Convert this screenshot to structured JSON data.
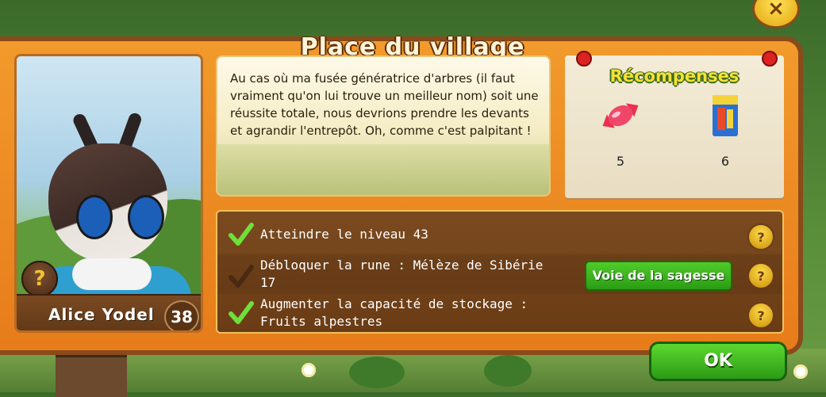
{
  "window": {
    "title": "Place du village",
    "close_label": "×"
  },
  "character": {
    "name": "Alice Yodel",
    "level": "38",
    "help_label": "?"
  },
  "dialog": {
    "text": "Au cas où ma fusée génératrice d'arbres (il faut vraiment qu'on lui trouve un meilleur nom) soit une réussite totale, nous devrions prendre les devants et agrandir l'entrepôt. Oh, comme c'est palpitant !"
  },
  "rewards": {
    "heading": "Récompenses",
    "items": [
      {
        "icon": "candy-icon",
        "count": "5"
      },
      {
        "icon": "seed-packet-icon",
        "count": "6"
      }
    ]
  },
  "tasks": [
    {
      "text": "Atteindre le niveau 43",
      "done": true,
      "help": "?"
    },
    {
      "text": "Débloquer la rune : Mélèze de Sibérie 17",
      "done": false,
      "help": "?",
      "action_label": "Voie de la sagesse"
    },
    {
      "text": "Augmenter la capacité de stockage : Fruits alpestres",
      "done": true,
      "help": "?"
    }
  ],
  "buttons": {
    "ok_label": "OK"
  },
  "colors": {
    "frame": "#e77c1a",
    "accent_green": "#2b9c15",
    "gold": "#f5e03a"
  }
}
